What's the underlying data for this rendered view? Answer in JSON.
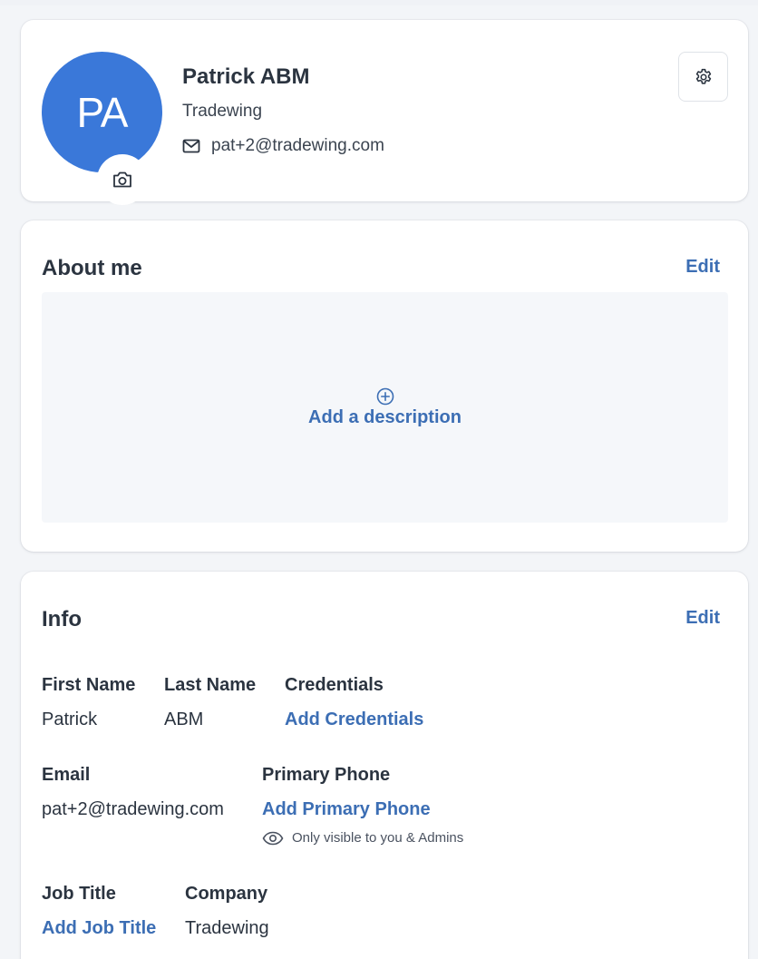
{
  "profile": {
    "initials": "PA",
    "name": "Patrick ABM",
    "company": "Tradewing",
    "email": "pat+2@tradewing.com"
  },
  "about": {
    "title": "About me",
    "edit_label": "Edit",
    "add_description_label": "Add a description"
  },
  "info": {
    "title": "Info",
    "edit_label": "Edit",
    "first_name": {
      "label": "First Name",
      "value": "Patrick"
    },
    "last_name": {
      "label": "Last Name",
      "value": "ABM"
    },
    "credentials": {
      "label": "Credentials",
      "action": "Add Credentials"
    },
    "email": {
      "label": "Email",
      "value": "pat+2@tradewing.com"
    },
    "primary_phone": {
      "label": "Primary Phone",
      "action": "Add Primary Phone"
    },
    "visibility_note": "Only visible to you & Admins",
    "job_title": {
      "label": "Job Title",
      "action": "Add Job Title"
    },
    "company": {
      "label": "Company",
      "value": "Tradewing"
    }
  },
  "colors": {
    "avatar_bg": "#3a78d9",
    "link": "#3c6eb4",
    "text": "#2b3440",
    "page_bg": "#f3f5f8"
  },
  "icons": {
    "avatar_upload": "camera-icon",
    "email": "mail-icon",
    "settings": "gear-icon",
    "add": "plus-circle-icon",
    "visibility": "eye-icon"
  }
}
